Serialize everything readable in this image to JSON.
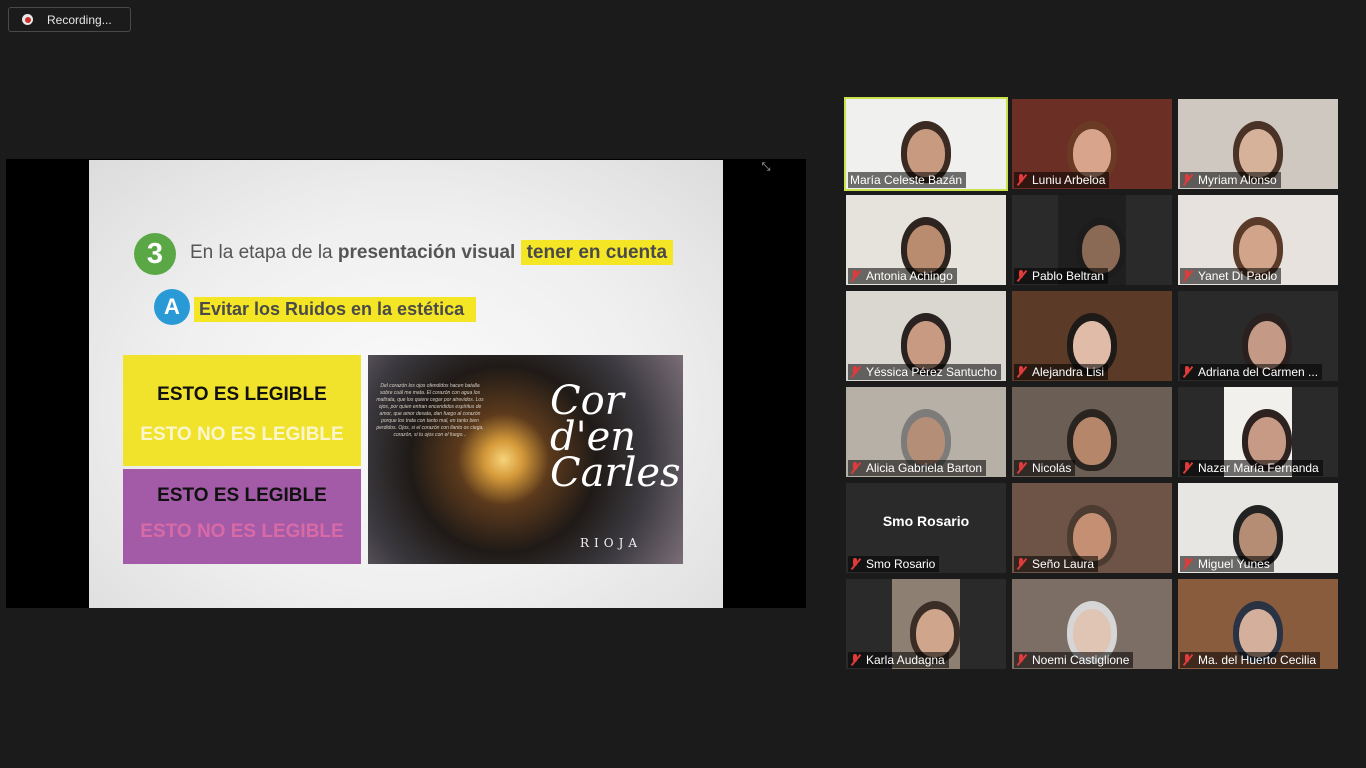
{
  "recording": {
    "label": "Recording..."
  },
  "slide": {
    "number": "3",
    "line1_prefix": "En la etapa de la ",
    "line1_bold": "presentación visual",
    "line1_highlight": "tener en cuenta",
    "sub_letter": "A",
    "sub_text": "Evitar los Ruidos en la estética",
    "yellow_box": {
      "legible": "ESTO ES LEGIBLE",
      "not_legible": "ESTO NO ES LEGIBLE"
    },
    "purple_box": {
      "legible": "ESTO ES LEGIBLE",
      "not_legible": "ESTO NO ES LEGIBLE"
    },
    "photo": {
      "poem": "Del corazón los ojos ofendidos hacen batalla sobre cuál me mata. El corazón con agua los maltrata, que los quiere cegar por atrevidos. Los ojos, por quien entran encendidos espíritus de amor, que amor desata, dan fuego al corazón porque los trata con tanto mal, en tanto bien perdidos. Ojos, si el corazón con llanto os ciega, corazón, si tu ojos con el fuego...",
      "logo_line1": "Cor d'en",
      "logo_line2": "Carles",
      "brand": "RIOJA"
    }
  },
  "participants": [
    {
      "name": "María Celeste Bazán",
      "muted": false,
      "active": true
    },
    {
      "name": "Luniu Arbeloa",
      "muted": true
    },
    {
      "name": "Myriam Alonso",
      "muted": true
    },
    {
      "name": "Antonia Achingo",
      "muted": true
    },
    {
      "name": "Pablo Beltran",
      "muted": true
    },
    {
      "name": "Yanet Di Paolo",
      "muted": true
    },
    {
      "name": "Yéssica Pérez Santucho",
      "muted": true
    },
    {
      "name": "Alejandra Lisi",
      "muted": true
    },
    {
      "name": "Adriana del Carmen ...",
      "muted": true
    },
    {
      "name": "Alicia Gabriela Barton",
      "muted": true
    },
    {
      "name": "Nicolás",
      "muted": true
    },
    {
      "name": "Nazar María Fernanda",
      "muted": true
    },
    {
      "name": "Smo Rosario",
      "muted": true,
      "video_off": true,
      "display_name": "Smo Rosario"
    },
    {
      "name": "Seño Laura",
      "muted": true
    },
    {
      "name": "Miguel Yunes",
      "muted": true
    },
    {
      "name": "Karla Audagna",
      "muted": true
    },
    {
      "name": "Noemi Castiglione",
      "muted": true
    },
    {
      "name": "Ma. del Huerto Cecilia",
      "muted": true
    }
  ],
  "colors": {
    "background": "#1b1b1b",
    "active_speaker_border": "#c8e34a",
    "muted_icon": "#e03a3a",
    "slide_highlight": "#f4e625",
    "number_badge": "#5aa845",
    "letter_badge": "#2a9ad6",
    "purple_box": "#a35ba8",
    "yellow_box": "#f1e22b"
  }
}
